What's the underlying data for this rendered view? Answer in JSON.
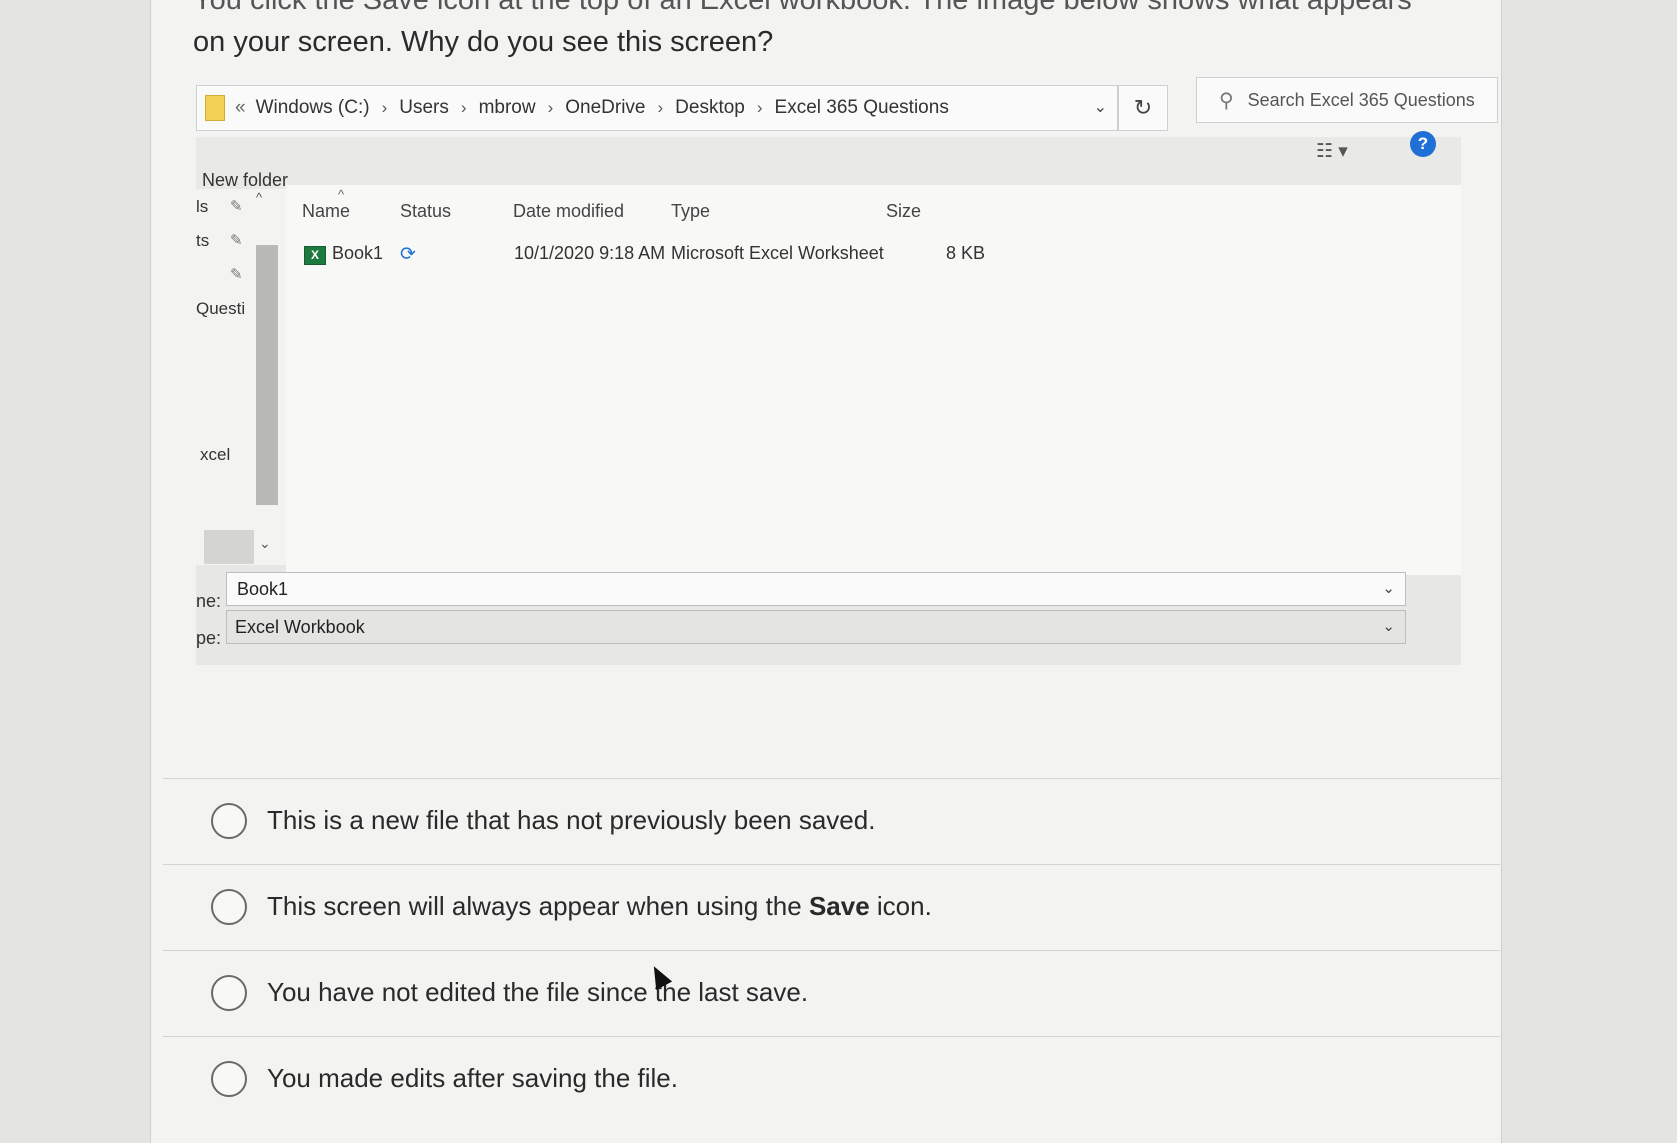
{
  "question": {
    "partial_line": "You click the Save icon at the top of an Excel workbook. The image below shows what appears",
    "line": "on your screen. Why do you see this screen?"
  },
  "dialog": {
    "breadcrumb": [
      "Windows (C:)",
      "Users",
      "mbrow",
      "OneDrive",
      "Desktop",
      "Excel 365 Questions"
    ],
    "breadcrumb_prefix": "«",
    "search_placeholder": "Search Excel 365 Questions",
    "new_folder": "New folder",
    "help": "?",
    "nav_items": [
      "ls",
      "ts",
      "Questi",
      "xcel"
    ],
    "columns": {
      "name": "Name",
      "status": "Status",
      "date": "Date modified",
      "type": "Type",
      "size": "Size"
    },
    "files": [
      {
        "name": "Book1",
        "date": "10/1/2020 9:18 AM",
        "type": "Microsoft Excel Worksheet",
        "size": "8 KB"
      }
    ],
    "file_name_label": "ne:",
    "file_name_value": "Book1",
    "save_type_label": "pe:",
    "save_type_value": "Excel Workbook"
  },
  "choices": [
    {
      "text": "This is a new file that has not previously been saved."
    },
    {
      "before": "This screen will always appear when using the ",
      "bold": "Save",
      "after": " icon."
    },
    {
      "text": "You have not edited the file since the last save."
    },
    {
      "text": "You made edits after saving the file."
    }
  ]
}
